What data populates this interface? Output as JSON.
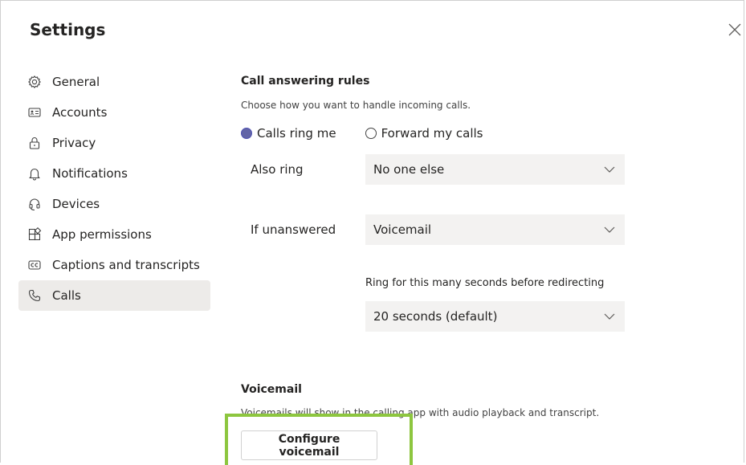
{
  "dialog": {
    "title": "Settings",
    "close_icon": "close-icon"
  },
  "nav": {
    "items": [
      {
        "label": "General",
        "icon": "gear-icon"
      },
      {
        "label": "Accounts",
        "icon": "id-card-icon"
      },
      {
        "label": "Privacy",
        "icon": "lock-icon"
      },
      {
        "label": "Notifications",
        "icon": "bell-icon"
      },
      {
        "label": "Devices",
        "icon": "headset-icon"
      },
      {
        "label": "App permissions",
        "icon": "apps-icon"
      },
      {
        "label": "Captions and transcripts",
        "icon": "captions-icon"
      },
      {
        "label": "Calls",
        "icon": "phone-icon"
      }
    ],
    "active": "Calls"
  },
  "call_rules": {
    "heading": "Call answering rules",
    "description": "Choose how you want to handle incoming calls.",
    "option_ring": "Calls ring me",
    "option_forward": "Forward my calls",
    "selected": "Calls ring me",
    "also_ring_label": "Also ring",
    "also_ring_value": "No one else",
    "unanswered_label": "If unanswered",
    "unanswered_value": "Voicemail",
    "ring_seconds_label": "Ring for this many seconds before redirecting",
    "ring_seconds_value": "20 seconds (default)"
  },
  "voicemail": {
    "heading": "Voicemail",
    "description": "Voicemails will show in the calling app with audio playback and transcript.",
    "configure_button": "Configure voicemail"
  },
  "colors": {
    "accent": "#6264a7",
    "highlight": "#8dc63f",
    "active_nav": "#edebe9",
    "select_bg": "#f3f2f1"
  }
}
